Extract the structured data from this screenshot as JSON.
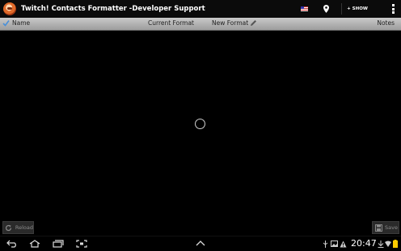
{
  "action_bar": {
    "title": "Twitch! Contacts Formatter -Developer Support",
    "show_label": "+ SHOW",
    "icons": [
      "app-icon",
      "flag-icon",
      "location-pin-icon",
      "overflow-menu-icon"
    ]
  },
  "columns": {
    "name": "Name",
    "current_format": "Current Format",
    "new_format": "New Format",
    "notes": "Notes"
  },
  "buttons": {
    "reload": "Reload",
    "save": "Save"
  },
  "status_bar": {
    "time": "20:47",
    "nav_icons": [
      "back-icon",
      "home-icon",
      "recent-apps-icon",
      "screenshot-icon",
      "up-arrow-icon"
    ],
    "status_icons": [
      "usb-icon",
      "image-icon",
      "warning-icon",
      "download-icon",
      "wifi-icon",
      "battery-icon"
    ]
  },
  "colors": {
    "background": "#000000",
    "header_gradient_top": "#c9c9c9",
    "header_gradient_bottom": "#9d9d9d",
    "check_accent": "#4a90d9"
  }
}
